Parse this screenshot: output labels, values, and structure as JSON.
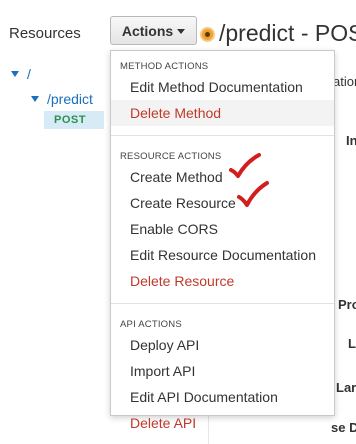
{
  "resources": {
    "title": "Resources",
    "tree": {
      "root_label": "/",
      "child_label": "/predict",
      "method_label": "POST"
    }
  },
  "toolbar": {
    "actions_label": "Actions"
  },
  "header": {
    "title": "/predict - POST"
  },
  "background_labels": {
    "ation": "ation",
    "in": "In",
    "pro": "Pro",
    "l": "L",
    "lar": "Lar",
    "se_d": "se D"
  },
  "menu": {
    "sections": [
      {
        "header": "METHOD ACTIONS",
        "items": [
          {
            "label": "Edit Method Documentation",
            "danger": false
          },
          {
            "label": "Delete Method",
            "danger": true,
            "highlighted": true
          }
        ]
      },
      {
        "header": "RESOURCE ACTIONS",
        "items": [
          {
            "label": "Create Method",
            "danger": false,
            "checked": true
          },
          {
            "label": "Create Resource",
            "danger": false,
            "checked": true
          },
          {
            "label": "Enable CORS",
            "danger": false
          },
          {
            "label": "Edit Resource Documentation",
            "danger": false
          },
          {
            "label": "Delete Resource",
            "danger": true
          }
        ]
      },
      {
        "header": "API ACTIONS",
        "items": [
          {
            "label": "Deploy API",
            "danger": false
          },
          {
            "label": "Import API",
            "danger": false
          },
          {
            "label": "Edit API Documentation",
            "danger": false
          },
          {
            "label": "Delete API",
            "danger": true
          }
        ]
      }
    ]
  },
  "colors": {
    "link_blue": "#1a6fbf",
    "danger_red": "#c0392b",
    "method_green": "#2c8f4f",
    "check_red": "#d11e1e",
    "status_orange": "#f0a030"
  },
  "icons": {
    "tree_expand": "triangle-down-icon",
    "actions_caret": "caret-down-icon",
    "status": "status-dot-icon",
    "annotation": "checkmark-icon"
  }
}
